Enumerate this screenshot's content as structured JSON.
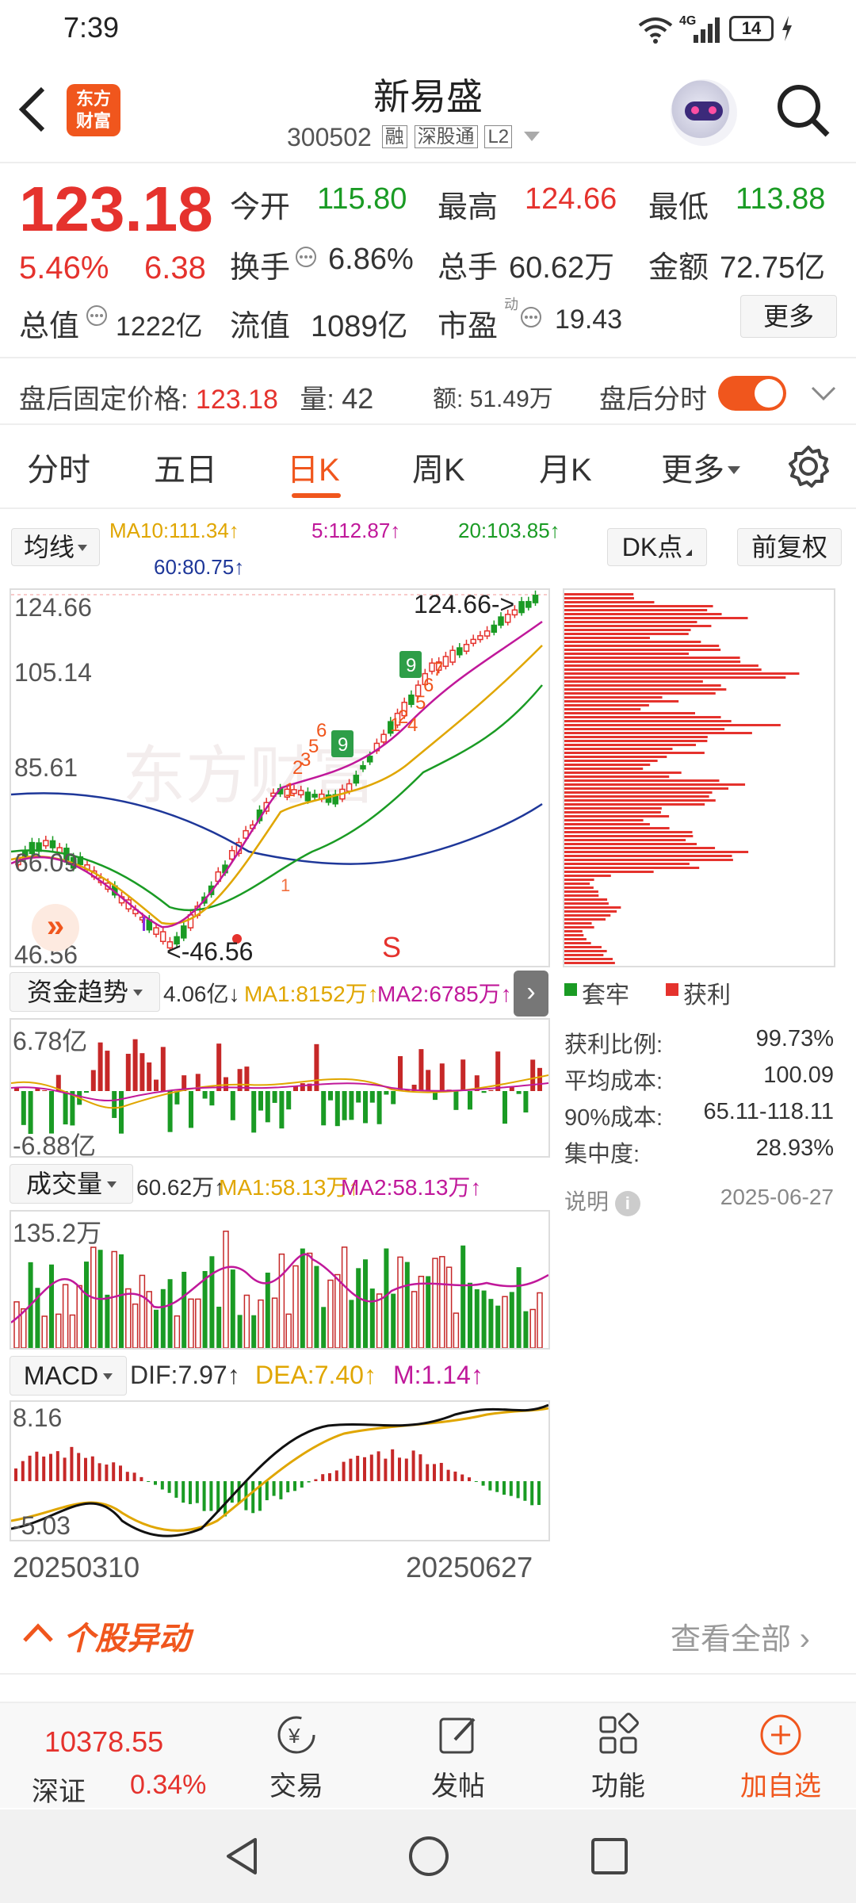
{
  "status_bar": {
    "time": "7:39",
    "network": "4G",
    "battery": "14"
  },
  "header": {
    "logo_text": "东方\n财富",
    "stock_name": "新易盛",
    "stock_code": "300502",
    "badges": [
      "融",
      "深股通",
      "L2"
    ]
  },
  "quote": {
    "price": "123.18",
    "change_pct": "5.46%",
    "change": "6.38",
    "open_label": "今开",
    "open": "115.80",
    "high_label": "最高",
    "high": "124.66",
    "low_label": "最低",
    "low": "113.88",
    "turnover_label": "换手",
    "turnover": "6.86%",
    "volume_label": "总手",
    "volume": "60.62万",
    "amount_label": "金额",
    "amount": "72.75亿",
    "mktcap_label": "总值",
    "mktcap": "1222亿",
    "float_label": "流值",
    "float_cap": "1089亿",
    "pe_label": "市盈",
    "pe_sup": "动",
    "pe": "19.43",
    "more_button": "更多"
  },
  "after_hours": {
    "label": "盘后固定价格:",
    "price": "123.18",
    "qty_label": "量:",
    "qty": "42",
    "amt_label": "额:",
    "amt": "51.49万",
    "toggle_label": "盘后分时",
    "toggle_on": true
  },
  "tabs": [
    {
      "label": "分时"
    },
    {
      "label": "五日"
    },
    {
      "label": "日K",
      "active": true
    },
    {
      "label": "周K"
    },
    {
      "label": "月K"
    },
    {
      "label": "更多"
    }
  ],
  "indicators": {
    "ma_button": "均线",
    "ma10": "MA10:111.34↑",
    "ma5": "5:112.87↑",
    "ma20": "20:103.85↑",
    "ma60": "60:80.75↑",
    "dk_button": "DK点",
    "adjust_button": "前复权"
  },
  "kline": {
    "y_labels": [
      "124.66",
      "105.14",
      "85.61",
      "66.09",
      "46.56"
    ],
    "high_note": "124.66->",
    "low_note": "<-46.56",
    "s_marker": "S",
    "watermark": "东方财富"
  },
  "fund_flow": {
    "button": "资金趋势",
    "value": "4.06亿↓",
    "ma1": "MA1:8152万↑",
    "ma2": "MA2:6785万↑",
    "y_top": "6.78亿",
    "y_bottom": "-6.88亿"
  },
  "volume_panel": {
    "button": "成交量",
    "value": "60.62万↑",
    "ma1": "MA1:58.13万↑",
    "ma2": "MA2:58.13万↑",
    "y_top": "135.2万"
  },
  "macd": {
    "button": "MACD",
    "dif": "DIF:7.97↑",
    "dea": "DEA:7.40↑",
    "m": "M:1.14↑",
    "y_top": "8.16",
    "y_bottom": "-5.03"
  },
  "dates": {
    "start": "20250310",
    "end": "20250627"
  },
  "chips": {
    "legend_trapped": "套牢",
    "legend_profit": "获利",
    "rows": [
      {
        "label": "获利比例:",
        "value": "99.73%"
      },
      {
        "label": "平均成本:",
        "value": "100.09"
      },
      {
        "label": "90%成本:",
        "value": "65.11-118.11"
      },
      {
        "label": "集中度:",
        "value": "28.93%"
      }
    ],
    "note_label": "说明",
    "date": "2025-06-27"
  },
  "movement": {
    "title": "个股异动",
    "link": "查看全部"
  },
  "bottom_bar": {
    "index_value": "10378.55",
    "index_name": "深证",
    "index_pct": "0.34%",
    "items": [
      "交易",
      "发帖",
      "功能",
      "加自选"
    ]
  },
  "colors": {
    "up": "#e5322d",
    "down": "#1a9b24",
    "accent": "#f0561d"
  }
}
